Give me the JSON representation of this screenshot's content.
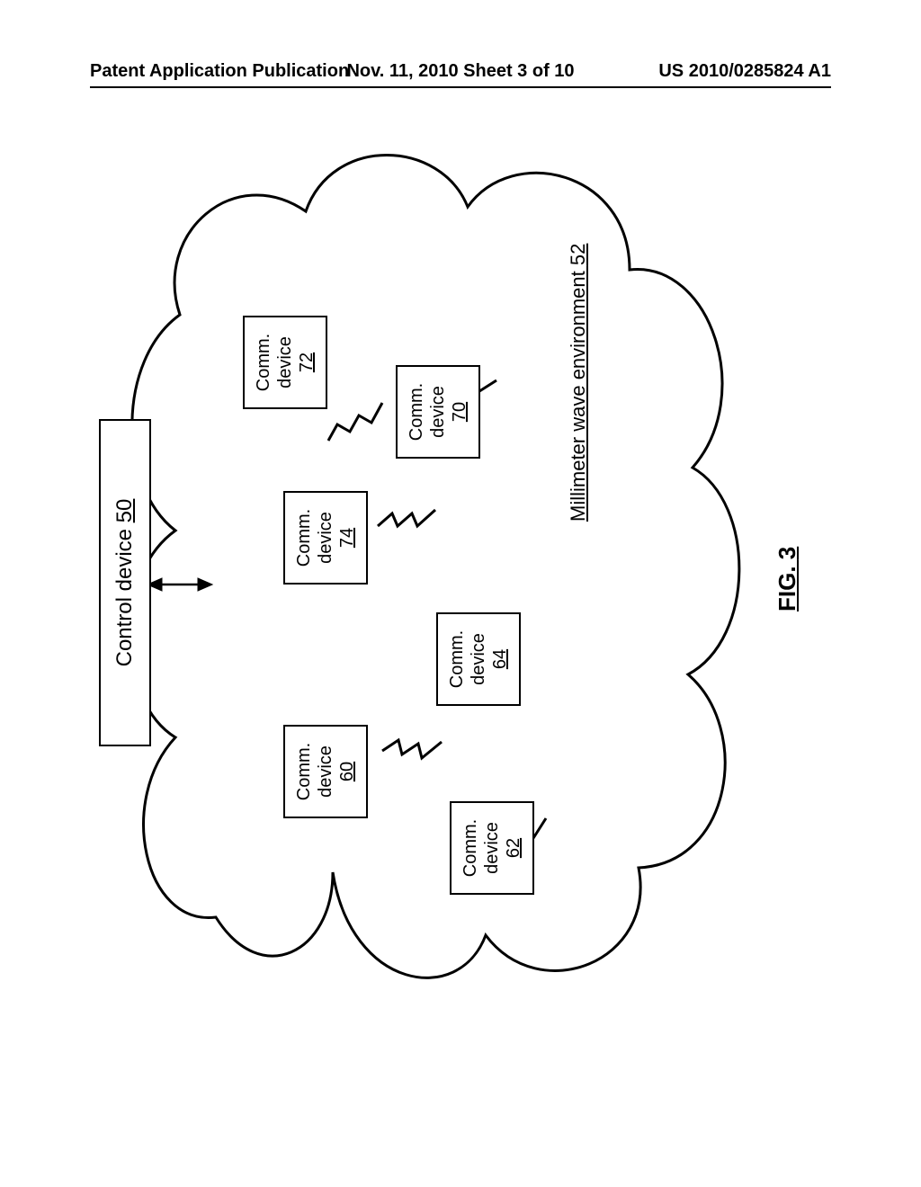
{
  "header": {
    "left": "Patent Application Publication",
    "center": "Nov. 11, 2010  Sheet 3 of 10",
    "right": "US 2010/0285824 A1"
  },
  "control": {
    "label_prefix": "Control device ",
    "ref": "50"
  },
  "environment": {
    "label_prefix": "Millimeter wave environment ",
    "ref": "52"
  },
  "devices": {
    "d60": {
      "line1": "Comm.",
      "line2": "device",
      "ref": "60"
    },
    "d62": {
      "line1": "Comm.",
      "line2": "device",
      "ref": "62"
    },
    "d64": {
      "line1": "Comm.",
      "line2": "device",
      "ref": "64"
    },
    "d70": {
      "line1": "Comm.",
      "line2": "device",
      "ref": "70"
    },
    "d72": {
      "line1": "Comm.",
      "line2": "device",
      "ref": "72"
    },
    "d74": {
      "line1": "Comm.",
      "line2": "device",
      "ref": "74"
    }
  },
  "figure": {
    "prefix": "FIG. ",
    "num": "3"
  }
}
